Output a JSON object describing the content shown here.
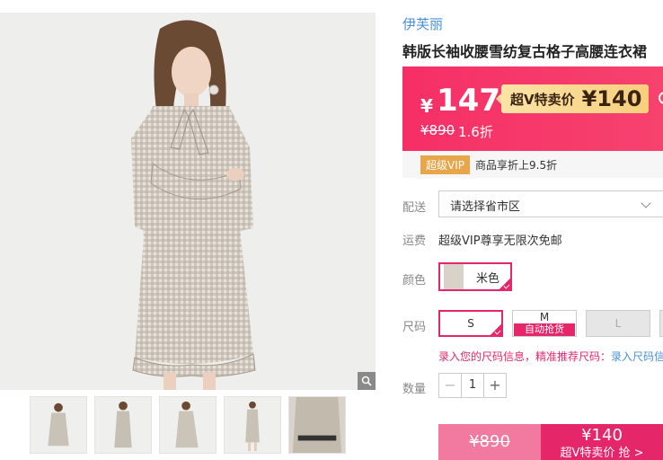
{
  "gallery": {
    "main_image": "checked-dress-model-photo",
    "zoom_icon": "magnifier-icon",
    "thumbnails": [
      "thumb-front",
      "thumb-side",
      "thumb-pose",
      "thumb-full",
      "thumb-collar-detail"
    ]
  },
  "product": {
    "brand": "伊芙丽",
    "title": "韩版长袖收腰雪纺复古格子高腰连衣裙"
  },
  "price": {
    "currency": "¥",
    "current": "147",
    "vip_label": "超V特卖价",
    "vip_price": "¥140",
    "original": "¥890",
    "discount": "1.6折"
  },
  "vip_promo": {
    "badge": "超级VIP",
    "note": "商品享折上9.5折"
  },
  "delivery": {
    "label": "配送",
    "placeholder": "请选择省市区"
  },
  "shipping": {
    "label": "运费",
    "text": "超级VIP尊享无限次免邮"
  },
  "color": {
    "label": "颜色",
    "selected": "米色"
  },
  "size": {
    "label": "尺码",
    "options": [
      {
        "label": "S",
        "state": "selected"
      },
      {
        "label": "M",
        "tag": "自动抢货",
        "state": "available"
      },
      {
        "label": "L",
        "state": "disabled"
      }
    ],
    "tip": "录入您的尺码信息，精准推荐尺码：",
    "tip_link": "录入尺码信"
  },
  "quantity": {
    "label": "数量",
    "value": "1",
    "minus": "−",
    "plus": "+"
  },
  "buy": {
    "original": "¥890",
    "vip_price": "¥140",
    "vip_label": "超V特卖价 抢 >"
  },
  "colors": {
    "accent": "#e5276a",
    "price_bg": "#f52f66",
    "link": "#4a90d9",
    "vip_gold": "#f7cf7d"
  }
}
